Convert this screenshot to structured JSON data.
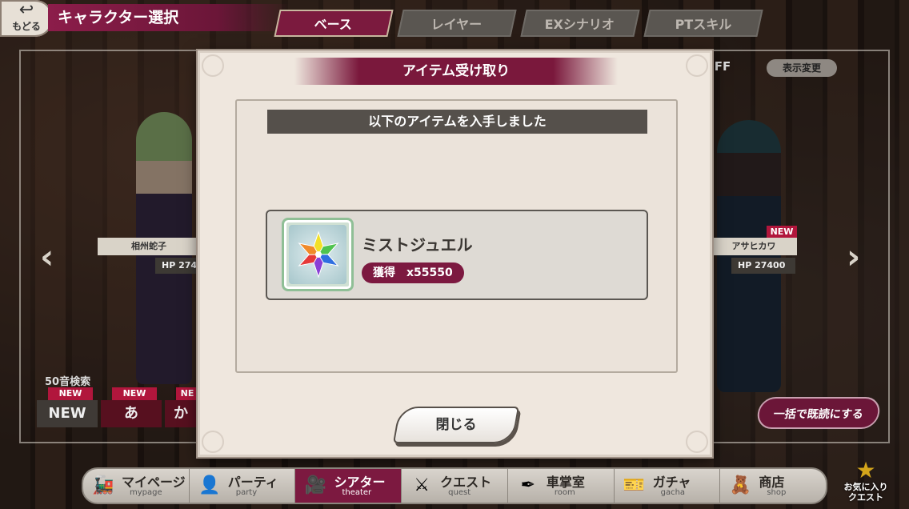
{
  "header": {
    "back_label": "もどる",
    "title": "キャラクター選択",
    "tabs": [
      {
        "label": "ベース",
        "active": true
      },
      {
        "label": "レイヤー",
        "active": false
      },
      {
        "label": "EXシナリオ",
        "active": false
      },
      {
        "label": "PTスキル",
        "active": false
      }
    ],
    "toggle_value": "OFF",
    "display_change_label": "表示変更"
  },
  "characters": [
    {
      "name": "相州蛇子",
      "hp": "HP 274"
    },
    {
      "name": "アサヒカワ",
      "hp": "HP 27400",
      "badge": "NEW"
    }
  ],
  "filters": {
    "kana_label": "50音検索",
    "buttons": [
      {
        "label": "NEW",
        "badge": "NEW"
      },
      {
        "label": "あ",
        "badge": "NEW"
      },
      {
        "label": "か",
        "badge": "NE"
      }
    ],
    "mark_all_read_label": "一括で既読にする"
  },
  "modal": {
    "title": "アイテム受け取り",
    "header": "以下のアイテムを入手しました",
    "item": {
      "name": "ミストジュエル",
      "acquired_label": "獲得",
      "count": "x55550",
      "icon": "rainbow-jewel-icon"
    },
    "close_label": "閉じる"
  },
  "nav": [
    {
      "label": "マイページ",
      "sub": "mypage",
      "icon": "train-icon",
      "active": false
    },
    {
      "label": "パーティ",
      "sub": "party",
      "icon": "party-icon",
      "active": false
    },
    {
      "label": "シアター",
      "sub": "theater",
      "icon": "theater-icon",
      "active": true
    },
    {
      "label": "クエスト",
      "sub": "quest",
      "icon": "swords-icon",
      "active": false
    },
    {
      "label": "車掌室",
      "sub": "room",
      "icon": "pen-icon",
      "active": false
    },
    {
      "label": "ガチャ",
      "sub": "gacha",
      "icon": "ticket-icon",
      "active": false
    },
    {
      "label": "商店",
      "sub": "shop",
      "icon": "shopkeeper-icon",
      "active": false
    }
  ],
  "favorite_quest": {
    "label_line1": "お気に入り",
    "label_line2": "クエスト"
  },
  "colors": {
    "accent": "#7b1a3e",
    "panel": "#efe7de",
    "dark": "#55504b"
  }
}
